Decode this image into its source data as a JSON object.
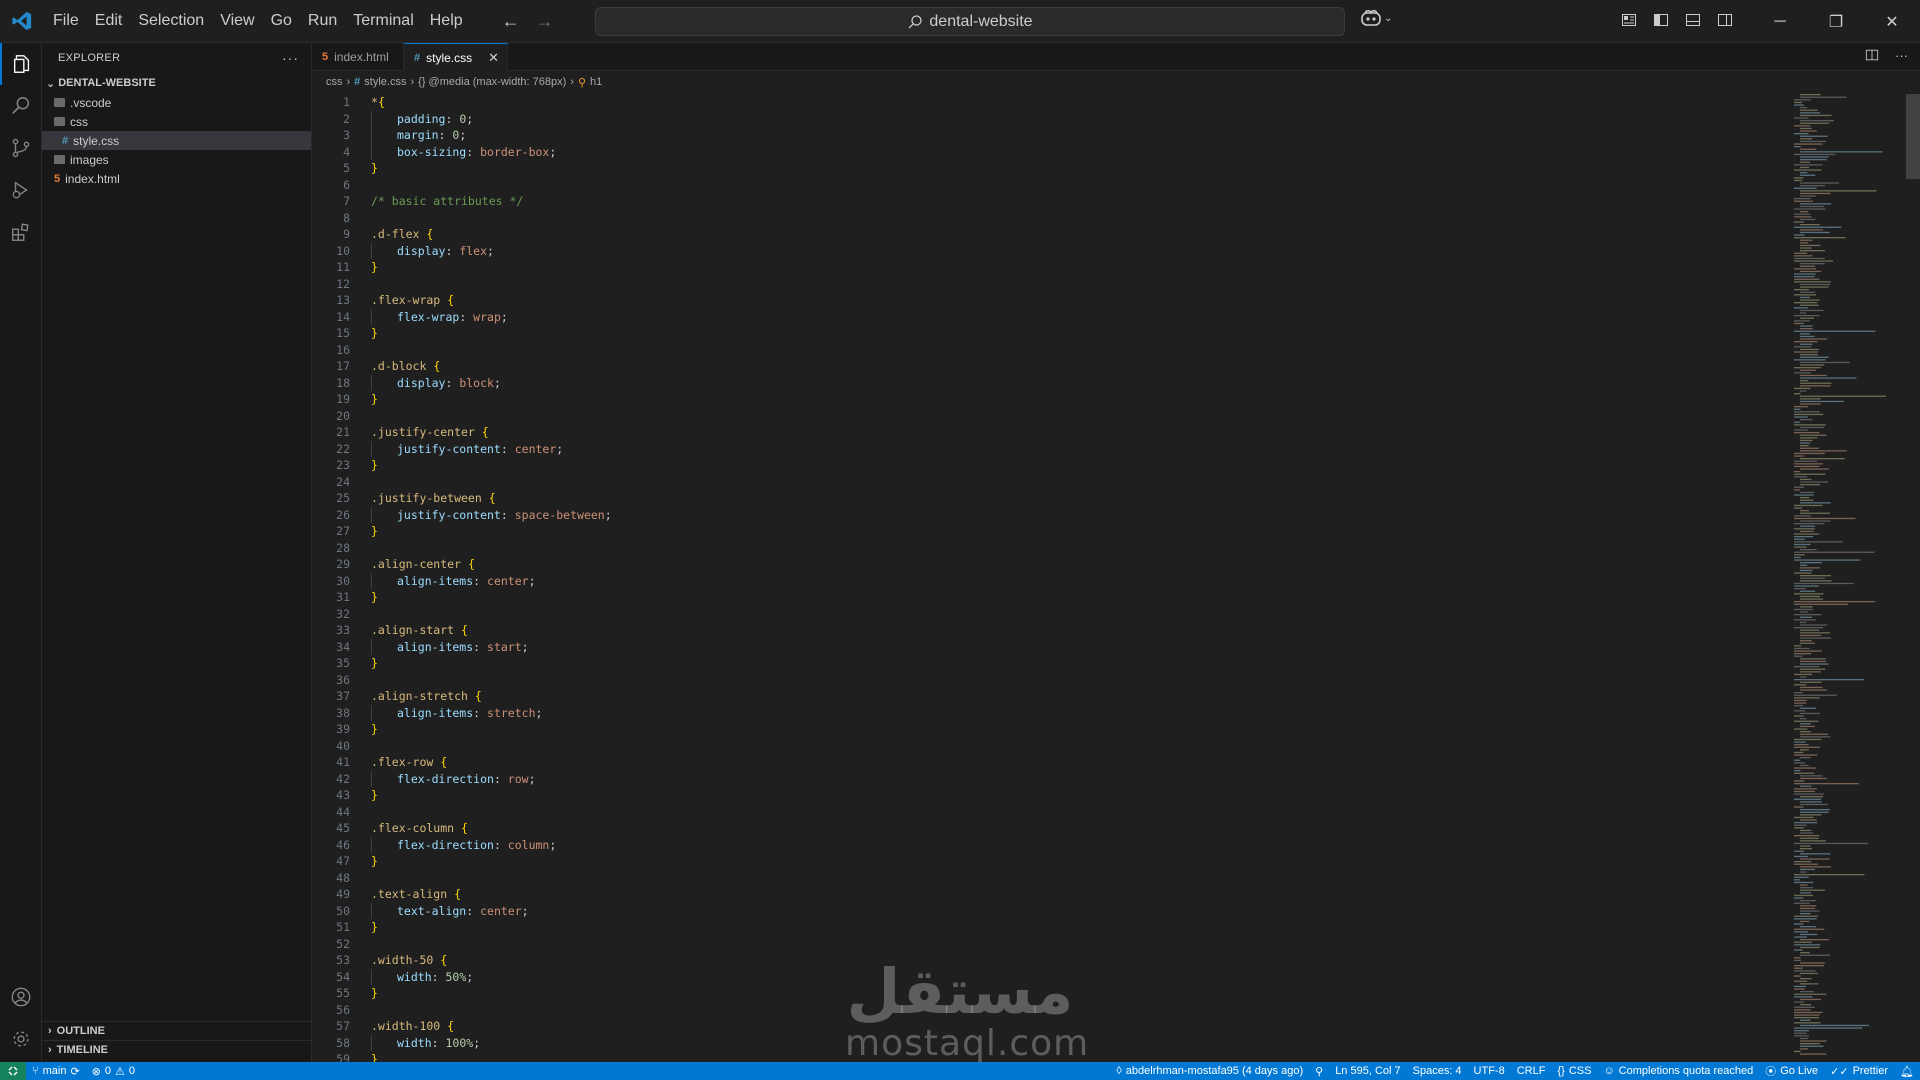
{
  "window": {
    "menu": [
      "File",
      "Edit",
      "Selection",
      "View",
      "Go",
      "Run",
      "Terminal",
      "Help"
    ],
    "search_label": "dental-website"
  },
  "sidebar": {
    "title": "EXPLORER",
    "root": "DENTAL-WEBSITE",
    "items": [
      {
        "label": ".vscode",
        "type": "folder",
        "indent": 1
      },
      {
        "label": "css",
        "type": "folder",
        "indent": 1
      },
      {
        "label": "style.css",
        "type": "css",
        "indent": 2,
        "selected": true
      },
      {
        "label": "images",
        "type": "folder",
        "indent": 1
      },
      {
        "label": "index.html",
        "type": "html",
        "indent": 1
      }
    ],
    "outline": "OUTLINE",
    "timeline": "TIMELINE"
  },
  "tabs": [
    {
      "label": "index.html",
      "type": "html",
      "active": false
    },
    {
      "label": "style.css",
      "type": "css",
      "active": true
    }
  ],
  "breadcrumbs": {
    "folder": "css",
    "file": "style.css",
    "media": "{} @media (max-width: 768px)",
    "symbol": "h1"
  },
  "code_lines": [
    [
      [
        "sel",
        "*"
      ],
      [
        "brace",
        "{"
      ]
    ],
    [
      [
        "i",
        ""
      ],
      [
        "prop",
        "padding"
      ],
      [
        "punc",
        ": "
      ],
      [
        "num",
        "0"
      ],
      [
        "punc",
        ";"
      ]
    ],
    [
      [
        "i",
        ""
      ],
      [
        "prop",
        "margin"
      ],
      [
        "punc",
        ": "
      ],
      [
        "num",
        "0"
      ],
      [
        "punc",
        ";"
      ]
    ],
    [
      [
        "i",
        ""
      ],
      [
        "prop",
        "box-sizing"
      ],
      [
        "punc",
        ": "
      ],
      [
        "val",
        "border-box"
      ],
      [
        "punc",
        ";"
      ]
    ],
    [
      [
        "brace",
        "}"
      ]
    ],
    [],
    [
      [
        "cmt",
        "/* basic attributes */"
      ]
    ],
    [],
    [
      [
        "sel",
        ".d-flex "
      ],
      [
        "brace",
        "{"
      ]
    ],
    [
      [
        "i",
        ""
      ],
      [
        "prop",
        "display"
      ],
      [
        "punc",
        ": "
      ],
      [
        "val",
        "flex"
      ],
      [
        "punc",
        ";"
      ]
    ],
    [
      [
        "brace",
        "}"
      ]
    ],
    [],
    [
      [
        "sel",
        ".flex-wrap "
      ],
      [
        "brace",
        "{"
      ]
    ],
    [
      [
        "i",
        ""
      ],
      [
        "prop",
        "flex-wrap"
      ],
      [
        "punc",
        ": "
      ],
      [
        "val",
        "wrap"
      ],
      [
        "punc",
        ";"
      ]
    ],
    [
      [
        "brace",
        "}"
      ]
    ],
    [],
    [
      [
        "sel",
        ".d-block "
      ],
      [
        "brace",
        "{"
      ]
    ],
    [
      [
        "i",
        ""
      ],
      [
        "prop",
        "display"
      ],
      [
        "punc",
        ": "
      ],
      [
        "val",
        "block"
      ],
      [
        "punc",
        ";"
      ]
    ],
    [
      [
        "brace",
        "}"
      ]
    ],
    [],
    [
      [
        "sel",
        ".justify-center "
      ],
      [
        "brace",
        "{"
      ]
    ],
    [
      [
        "i",
        ""
      ],
      [
        "prop",
        "justify-content"
      ],
      [
        "punc",
        ": "
      ],
      [
        "val",
        "center"
      ],
      [
        "punc",
        ";"
      ]
    ],
    [
      [
        "brace",
        "}"
      ]
    ],
    [],
    [
      [
        "sel",
        ".justify-between "
      ],
      [
        "brace",
        "{"
      ]
    ],
    [
      [
        "i",
        ""
      ],
      [
        "prop",
        "justify-content"
      ],
      [
        "punc",
        ": "
      ],
      [
        "val",
        "space-between"
      ],
      [
        "punc",
        ";"
      ]
    ],
    [
      [
        "brace",
        "}"
      ]
    ],
    [],
    [
      [
        "sel",
        ".align-center "
      ],
      [
        "brace",
        "{"
      ]
    ],
    [
      [
        "i",
        ""
      ],
      [
        "prop",
        "align-items"
      ],
      [
        "punc",
        ": "
      ],
      [
        "val",
        "center"
      ],
      [
        "punc",
        ";"
      ]
    ],
    [
      [
        "brace",
        "}"
      ]
    ],
    [],
    [
      [
        "sel",
        ".align-start "
      ],
      [
        "brace",
        "{"
      ]
    ],
    [
      [
        "i",
        ""
      ],
      [
        "prop",
        "align-items"
      ],
      [
        "punc",
        ": "
      ],
      [
        "val",
        "start"
      ],
      [
        "punc",
        ";"
      ]
    ],
    [
      [
        "brace",
        "}"
      ]
    ],
    [],
    [
      [
        "sel",
        ".align-stretch "
      ],
      [
        "brace",
        "{"
      ]
    ],
    [
      [
        "i",
        ""
      ],
      [
        "prop",
        "align-items"
      ],
      [
        "punc",
        ": "
      ],
      [
        "val",
        "stretch"
      ],
      [
        "punc",
        ";"
      ]
    ],
    [
      [
        "brace",
        "}"
      ]
    ],
    [],
    [
      [
        "sel",
        ".flex-row "
      ],
      [
        "brace",
        "{"
      ]
    ],
    [
      [
        "i",
        ""
      ],
      [
        "prop",
        "flex-direction"
      ],
      [
        "punc",
        ": "
      ],
      [
        "val",
        "row"
      ],
      [
        "punc",
        ";"
      ]
    ],
    [
      [
        "brace",
        "}"
      ]
    ],
    [],
    [
      [
        "sel",
        ".flex-column "
      ],
      [
        "brace",
        "{"
      ]
    ],
    [
      [
        "i",
        ""
      ],
      [
        "prop",
        "flex-direction"
      ],
      [
        "punc",
        ": "
      ],
      [
        "val",
        "column"
      ],
      [
        "punc",
        ";"
      ]
    ],
    [
      [
        "brace",
        "}"
      ]
    ],
    [],
    [
      [
        "sel",
        ".text-align "
      ],
      [
        "brace",
        "{"
      ]
    ],
    [
      [
        "i",
        ""
      ],
      [
        "prop",
        "text-align"
      ],
      [
        "punc",
        ": "
      ],
      [
        "val",
        "center"
      ],
      [
        "punc",
        ";"
      ]
    ],
    [
      [
        "brace",
        "}"
      ]
    ],
    [],
    [
      [
        "sel",
        ".width-50 "
      ],
      [
        "brace",
        "{"
      ]
    ],
    [
      [
        "i",
        ""
      ],
      [
        "prop",
        "width"
      ],
      [
        "punc",
        ": "
      ],
      [
        "num",
        "50%"
      ],
      [
        "punc",
        ";"
      ]
    ],
    [
      [
        "brace",
        "}"
      ]
    ],
    [],
    [
      [
        "sel",
        ".width-100 "
      ],
      [
        "brace",
        "{"
      ]
    ],
    [
      [
        "i",
        ""
      ],
      [
        "prop",
        "width"
      ],
      [
        "punc",
        ": "
      ],
      [
        "num",
        "100%"
      ],
      [
        "punc",
        ";"
      ]
    ],
    [
      [
        "brace",
        "}"
      ]
    ]
  ],
  "watermark": {
    "arabic": "مستقل",
    "latin": "mostaql.com"
  },
  "statusbar": {
    "branch": "main",
    "problems": "0",
    "warnings": "0",
    "blame": "abdelrhman-mostafa95 (4 days ago)",
    "position": "Ln 595, Col 7",
    "spaces": "Spaces: 4",
    "encoding": "UTF-8",
    "eol": "CRLF",
    "language": "CSS",
    "completions": "Completions quota reached",
    "golive": "Go Live",
    "prettier": "Prettier"
  },
  "colors": {
    "accent": "#0078d4",
    "remote": "#16825d",
    "selector": "#d7ba7d",
    "property": "#9cdcfe",
    "value": "#ce9178",
    "number": "#b5cea8",
    "comment": "#6a9955"
  }
}
